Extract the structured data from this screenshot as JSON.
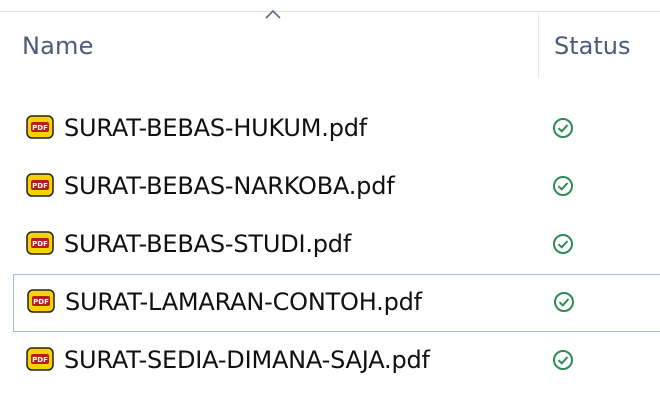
{
  "header": {
    "name_label": "Name",
    "status_label": "Status",
    "sort_icon": "chevron-up-icon"
  },
  "files": [
    {
      "name": "SURAT-BEBAS-HUKUM.pdf",
      "icon": "pdf-file-icon",
      "status_icon": "synced-check-icon",
      "focused": false
    },
    {
      "name": "SURAT-BEBAS-NARKOBA.pdf",
      "icon": "pdf-file-icon",
      "status_icon": "synced-check-icon",
      "focused": false
    },
    {
      "name": "SURAT-BEBAS-STUDI.pdf",
      "icon": "pdf-file-icon",
      "status_icon": "synced-check-icon",
      "focused": false
    },
    {
      "name": "SURAT-LAMARAN-CONTOH.pdf",
      "icon": "pdf-file-icon",
      "status_icon": "synced-check-icon",
      "focused": true
    },
    {
      "name": "SURAT-SEDIA-DIMANA-SAJA.pdf",
      "icon": "pdf-file-icon",
      "status_icon": "synced-check-icon",
      "focused": false
    }
  ],
  "colors": {
    "header_text": "#4a5a78",
    "status_green": "#2e8b57",
    "focus_border": "#9fc1e7",
    "pdf_yellow": "#f5d200"
  }
}
